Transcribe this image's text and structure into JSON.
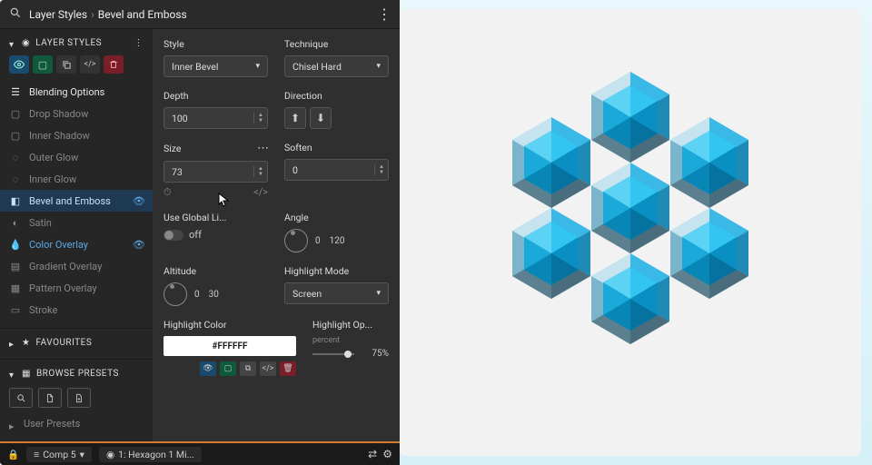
{
  "breadcrumb": {
    "root": "Layer Styles",
    "leaf": "Bevel and Emboss"
  },
  "section": {
    "layerStyles": "LAYER STYLES",
    "favourites": "FAVOURITES",
    "browsePresets": "BROWSE PRESETS",
    "userPresets": "User Presets"
  },
  "sidebar": {
    "items": [
      "Blending Options",
      "Drop Shadow",
      "Inner Shadow",
      "Outer Glow",
      "Inner Glow",
      "Bevel and Emboss",
      "Satin",
      "Color Overlay",
      "Gradient Overlay",
      "Pattern Overlay",
      "Stroke"
    ]
  },
  "controls": {
    "style": {
      "label": "Style",
      "value": "Inner Bevel"
    },
    "technique": {
      "label": "Technique",
      "value": "Chisel Hard"
    },
    "depth": {
      "label": "Depth",
      "value": "100"
    },
    "direction": {
      "label": "Direction"
    },
    "size": {
      "label": "Size",
      "value": "73"
    },
    "soften": {
      "label": "Soften",
      "value": "0"
    },
    "useGlobal": {
      "label": "Use Global Li...",
      "value": "off"
    },
    "angle": {
      "label": "Angle",
      "v1": "0",
      "v2": "120"
    },
    "altitude": {
      "label": "Altitude",
      "v1": "0",
      "v2": "30"
    },
    "highlightMode": {
      "label": "Highlight Mode",
      "value": "Screen"
    },
    "highlightColor": {
      "label": "Highlight Color",
      "value": "#FFFFFF"
    },
    "highlightOpacity": {
      "label": "Highlight Op...",
      "unit": "percent",
      "value": "75%"
    }
  },
  "footer": {
    "comp": "Comp 5",
    "layer": "1: Hexagon 1 Mi..."
  }
}
